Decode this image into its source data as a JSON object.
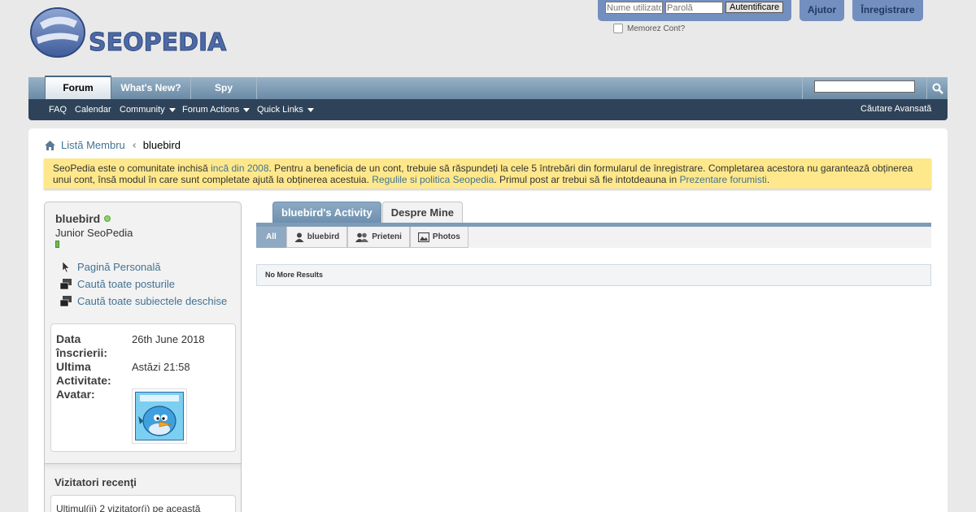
{
  "header": {
    "logo_text": "SEOPEDIA",
    "login": {
      "username_placeholder": "Nume utilizato",
      "password_placeholder": "Parolă",
      "submit_label": "Autentificare",
      "remember_label": "Memorez Cont?"
    },
    "help_label": "Ajutor",
    "register_label": "Înregistrare"
  },
  "navbar": {
    "tabs": [
      {
        "label": "Forum",
        "active": true
      },
      {
        "label": "What's New?",
        "active": false
      },
      {
        "label": "Spy",
        "active": false
      }
    ]
  },
  "subnav": {
    "items": [
      "FAQ",
      "Calendar",
      "Community",
      "Forum Actions",
      "Quick Links"
    ],
    "advanced_search": "Căutare Avansată"
  },
  "breadcrumb": {
    "members_list": "Listă Membru",
    "current": "bluebird"
  },
  "notice": {
    "part1": "SeoPedia este o comunitate inchisă ",
    "link1": "incă din 2008",
    "part2": ". Pentru a beneficia de un cont, trebuie să răspundeți la cele 5 întrebări din formularul de înregistrare. Completarea acestora nu garantează obținerea unui cont, însă modul în care sunt completate ajută la obținerea acestuia. ",
    "link2": "Regulile si politica Seopedia",
    "part3": ". Primul post ar trebui să fie intotdeauna in ",
    "link3": "Prezentare forumisti",
    "part4": "."
  },
  "profile": {
    "username": "bluebird",
    "user_title": "Junior SeoPedia",
    "links": [
      "Pagină Personală",
      "Caută toate posturile",
      "Caută toate subiectele deschise"
    ],
    "info": {
      "join_label": "Data înscrierii:",
      "join_value": "26th June 2018",
      "activity_label": "Ultima Activitate:",
      "activity_value": "Astăzi 21:58",
      "avatar_label": "Avatar:"
    },
    "visitors_heading": "Vizitatori recenţi",
    "visitors_text": "Ultimul(ii) 2 vizitator(i) pe această"
  },
  "main": {
    "tabs": [
      {
        "label": "bluebird's Activity",
        "active": true
      },
      {
        "label": "Despre Mine",
        "active": false
      }
    ],
    "subtabs": [
      {
        "label": "All",
        "active": true
      },
      {
        "label": "bluebird",
        "active": false
      },
      {
        "label": "Prieteni",
        "active": false
      },
      {
        "label": "Photos",
        "active": false
      }
    ],
    "no_results": "No More Results"
  },
  "colors": {
    "brand_blue": "#738fbf",
    "nav_dark": "#2e4359",
    "notice_yellow": "#ffe88b",
    "link": "#417394"
  }
}
